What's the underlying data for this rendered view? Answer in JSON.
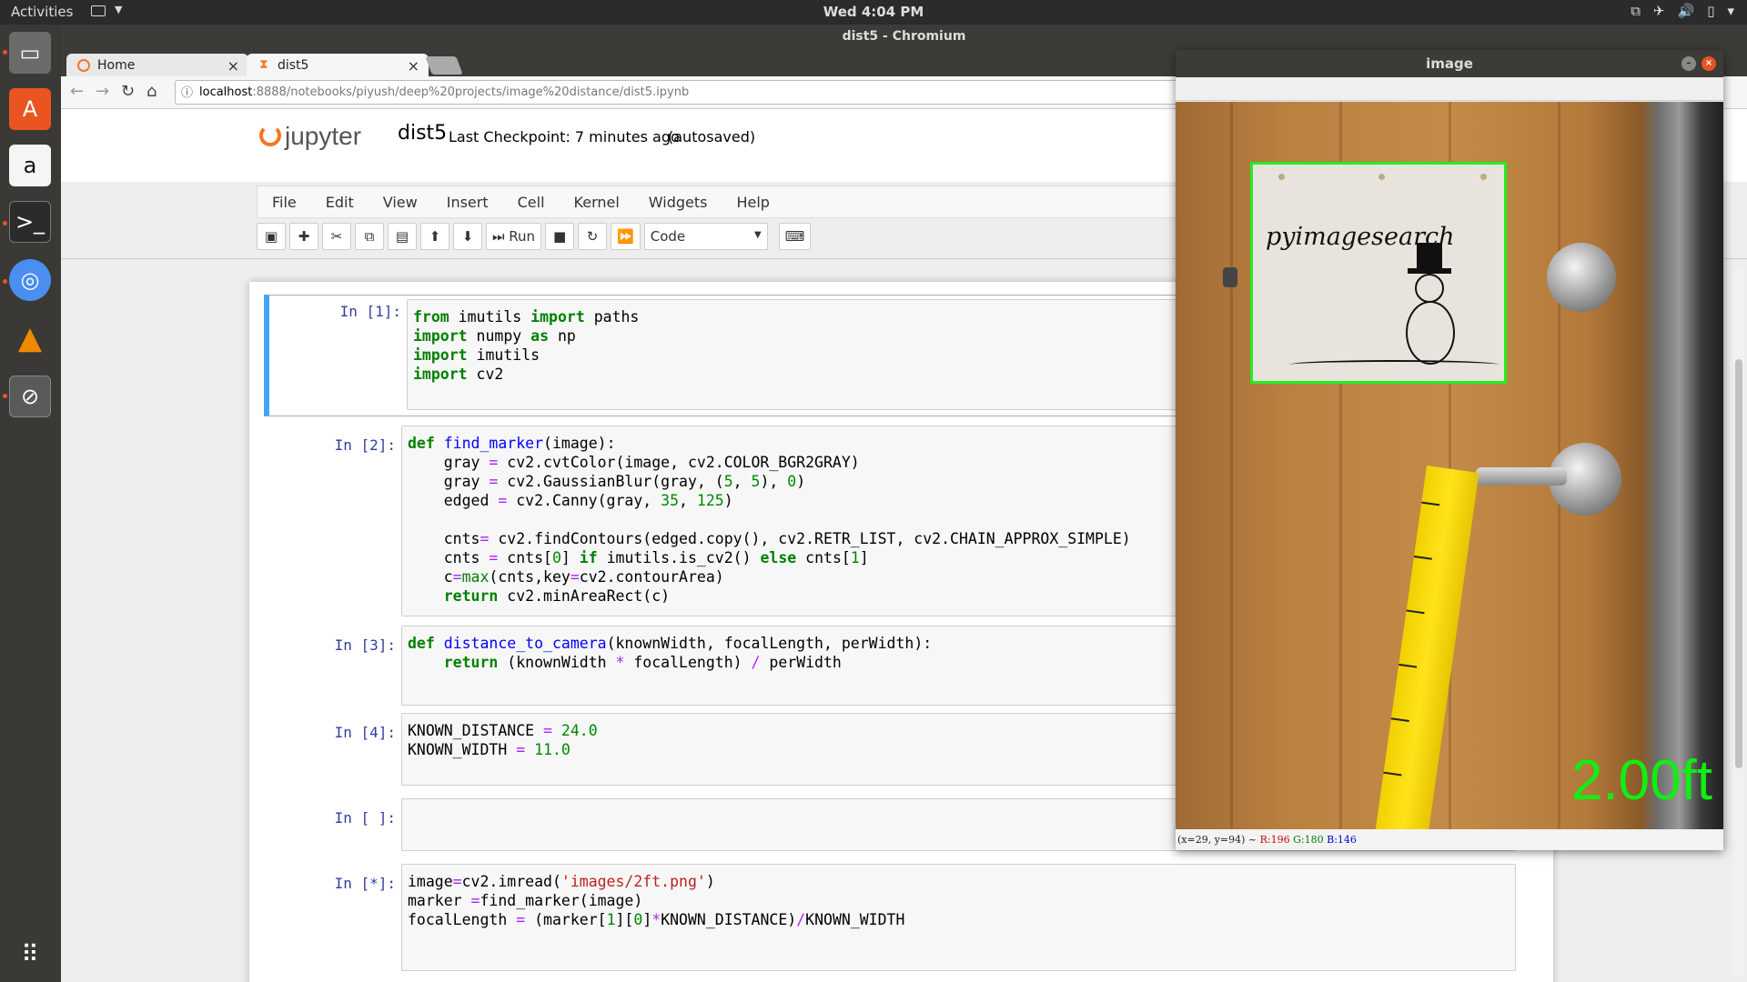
{
  "topbar": {
    "activities": "Activities",
    "clock": "Wed  4:04 PM"
  },
  "dock": {
    "items": [
      "files-icon",
      "ubuntu-software-icon",
      "amazon-icon",
      "terminal-icon",
      "chromium-icon",
      "vlc-icon",
      "app-icon"
    ]
  },
  "chrome": {
    "title": "dist5 - Chromium",
    "tabs": [
      {
        "label": "Home"
      },
      {
        "label": "dist5"
      }
    ],
    "url_host": "localhost",
    "url_path": ":8888/notebooks/piyush/deep%20projects/image%20distance/dist5.ipynb"
  },
  "jupyter": {
    "logo": "jupyter",
    "notebook_name": "dist5",
    "checkpoint": "Last Checkpoint: 7 minutes ago",
    "autosaved": "(autosaved)",
    "menu": [
      "File",
      "Edit",
      "View",
      "Insert",
      "Cell",
      "Kernel",
      "Widgets",
      "Help"
    ],
    "run_label": "Run",
    "cell_type": "Code"
  },
  "cells": [
    {
      "prompt": "In [1]:"
    },
    {
      "prompt": "In [2]:"
    },
    {
      "prompt": "In [3]:"
    },
    {
      "prompt": "In [4]:"
    },
    {
      "prompt": "In [ ]:"
    },
    {
      "prompt": "In [*]:"
    }
  ],
  "image_window": {
    "title": "image",
    "note_text": "pyimagesearch",
    "distance_readout": "2.00ft",
    "status": "(x=29, y=94) ~",
    "status_r": "R:196",
    "status_g": "G:180",
    "status_b": "B:146"
  },
  "colors": {
    "accent": "#42a5f5",
    "jupyter_orange": "#f37726",
    "detect_green": "#22ee22"
  }
}
